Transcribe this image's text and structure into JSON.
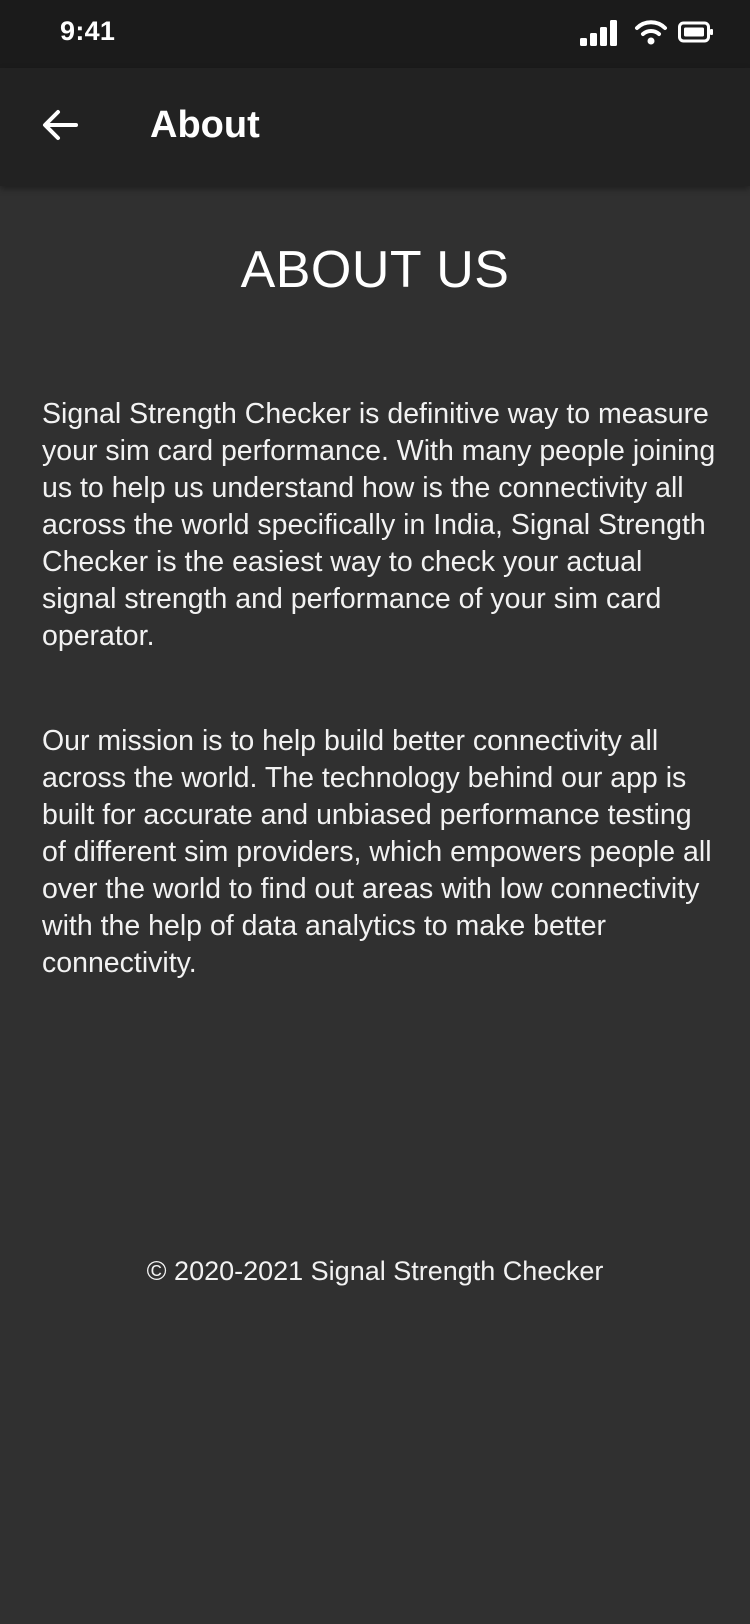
{
  "status_bar": {
    "time": "9:41",
    "icons": [
      "signal-icon",
      "wifi-icon",
      "battery-icon"
    ]
  },
  "app_bar": {
    "title": "About",
    "back_icon": "back-arrow-icon"
  },
  "content": {
    "heading": "ABOUT US",
    "paragraphs": [
      "Signal Strength Checker is definitive way to measure your sim card performance. With many people joining us to help us understand how is the connectivity all across the world specifically in India, Signal Strength Checker is the easiest way to check your actual signal strength and performance of your sim card operator.",
      "Our mission is to help build better connectivity all across the world. The technology behind our app is built for accurate and unbiased performance testing of different sim providers, which empowers people all over the world to find out areas with low connectivity with the help of data analytics to make better connectivity."
    ],
    "copyright": "© 2020-2021 Signal Strength Checker"
  },
  "colors": {
    "background": "#303030",
    "status_bar": "#1b1b1b",
    "app_bar": "#222222",
    "text": "#ffffff"
  }
}
